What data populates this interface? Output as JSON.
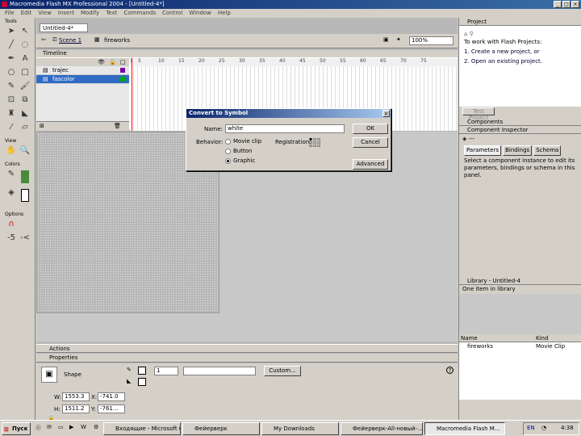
{
  "window": {
    "title": "Macromedia Flash MX Professional 2004 - [Untitled-4*]"
  },
  "menu": [
    "File",
    "Edit",
    "View",
    "Insert",
    "Modify",
    "Text",
    "Commands",
    "Control",
    "Window",
    "Help"
  ],
  "tools": {
    "header": "Tools",
    "view_label": "View",
    "colors_label": "Colors",
    "options_label": "Options"
  },
  "document": {
    "tab": "Untitled-4*",
    "scene": "Scene 1",
    "symbol": "fireworks",
    "zoom": "100%",
    "timeline_label": "Timeline",
    "layers": [
      {
        "name": "trajec"
      },
      {
        "name": "fascolor"
      }
    ],
    "frame_numbers": [
      "1",
      "5",
      "10",
      "15",
      "20",
      "25",
      "30",
      "35",
      "40",
      "45",
      "50",
      "55",
      "60",
      "65",
      "70",
      "75"
    ]
  },
  "dialog": {
    "title": "Convert to Symbol",
    "name_label": "Name:",
    "name_value": "white",
    "behavior_label": "Behavior:",
    "behaviors": [
      "Movie clip",
      "Button",
      "Graphic"
    ],
    "selected_behavior": "Graphic",
    "registration_label": "Registration:",
    "ok": "OK",
    "cancel": "Cancel",
    "advanced": "Advanced"
  },
  "panels": {
    "actions": "Actions",
    "properties": "Properties",
    "shape_label": "Shape",
    "custom_button": "Custom...",
    "w_label": "W:",
    "w_value": "1553.3",
    "h_label": "H:",
    "h_value": "1511.2",
    "x_label": "X:",
    "x_value": "-741.0",
    "y_label": "Y:",
    "y_value": "-761...",
    "stroke_size": "1"
  },
  "right": {
    "project_title": "Project",
    "project_text": "To work with Flash Projects:",
    "project_steps": [
      "1. Create a new project, or",
      "2. Open an existing project."
    ],
    "test_project": "Test Project",
    "components": "Components",
    "component_inspector": "Component Inspector",
    "ci_tabs": [
      "Parameters",
      "Bindings",
      "Schema"
    ],
    "ci_text": "Select a component instance to edit its parameters, bindings or schema in this panel.",
    "library_title": "Library - Untitled-4",
    "library_count": "One item in library",
    "library_cols": [
      "Name",
      "Kind"
    ],
    "library_items": [
      {
        "name": "fireworks",
        "kind": "Movie Clip"
      }
    ]
  },
  "taskbar": {
    "start": "Пуск",
    "items": [
      "Входящие - Microsoft O...",
      "Фейерверк",
      "My Downloads",
      "Фейерверк-All-новый-...",
      "Macromedia Flash M..."
    ],
    "clock": "4:38"
  }
}
